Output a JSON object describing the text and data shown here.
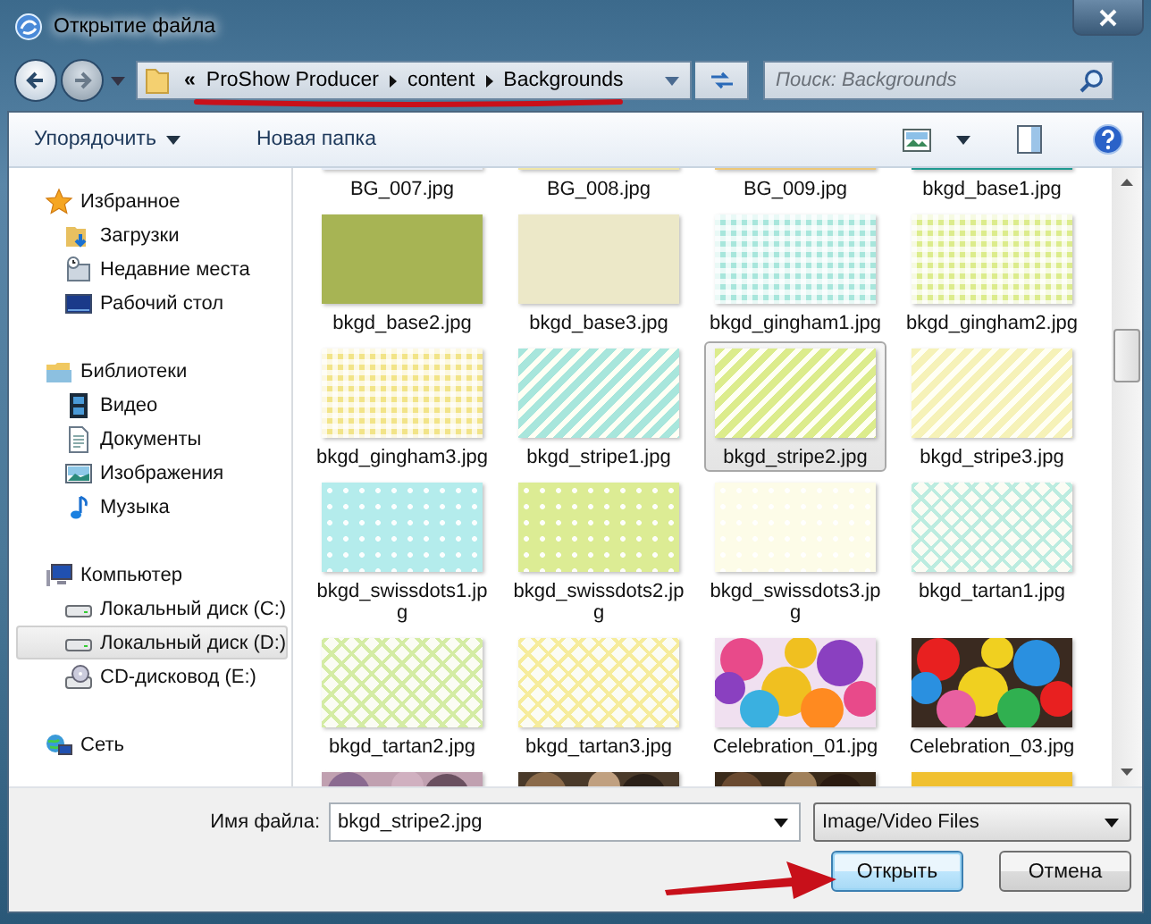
{
  "window": {
    "title": "Открытие файла"
  },
  "address": {
    "overflow": "«",
    "path": [
      "ProShow Producer",
      "content",
      "Backgrounds"
    ],
    "underlined": true
  },
  "search": {
    "placeholder": "Поиск: Backgrounds"
  },
  "toolbar": {
    "organize": "Упорядочить",
    "new_folder": "Новая папка"
  },
  "sidebar": {
    "groups": [
      {
        "label": "Избранное",
        "children": [
          {
            "label": "Загрузки",
            "selected": false
          },
          {
            "label": "Недавние места",
            "selected": false
          },
          {
            "label": "Рабочий стол",
            "selected": false
          }
        ]
      },
      {
        "label": "Библиотеки",
        "children": [
          {
            "label": "Видео",
            "selected": false
          },
          {
            "label": "Документы",
            "selected": false
          },
          {
            "label": "Изображения",
            "selected": false
          },
          {
            "label": "Музыка",
            "selected": false
          }
        ]
      },
      {
        "label": "Компьютер",
        "children": [
          {
            "label": "Локальный диск (C:)",
            "selected": false
          },
          {
            "label": "Локальный диск (D:)",
            "selected": true
          },
          {
            "label": "CD-дисковод (E:)",
            "selected": false
          }
        ]
      },
      {
        "label": "Сеть"
      }
    ]
  },
  "files": [
    {
      "name": "BG_007.jpg",
      "kind": "plain",
      "color": "#e8eef8",
      "selected": false
    },
    {
      "name": "BG_008.jpg",
      "kind": "plain",
      "color": "#f0e6a8",
      "selected": false
    },
    {
      "name": "BG_009.jpg",
      "kind": "plain",
      "color": "#ecc778",
      "selected": false
    },
    {
      "name": "bkgd_base1.jpg",
      "kind": "plain",
      "color": "#1f9a90",
      "selected": false
    },
    {
      "name": "bkgd_base2.jpg",
      "kind": "plain",
      "color": "#a7b454",
      "selected": false
    },
    {
      "name": "bkgd_base3.jpg",
      "kind": "plain",
      "color": "#ece8c8",
      "selected": false
    },
    {
      "name": "bkgd_gingham1.jpg",
      "kind": "gingham",
      "color": "#a8e6dc",
      "selected": false
    },
    {
      "name": "bkgd_gingham2.jpg",
      "kind": "gingham",
      "color": "#dcec8c",
      "selected": false
    },
    {
      "name": "bkgd_gingham3.jpg",
      "kind": "gingham",
      "color": "#f2e488",
      "selected": false
    },
    {
      "name": "bkgd_stripe1.jpg",
      "kind": "stripe",
      "color": "#a8e6dc",
      "selected": false
    },
    {
      "name": "bkgd_stripe2.jpg",
      "kind": "stripe",
      "color": "#dcec8c",
      "selected": true
    },
    {
      "name": "bkgd_stripe3.jpg",
      "kind": "stripe",
      "color": "#f6f2b8",
      "selected": false
    },
    {
      "name": "bkgd_swissdots1.jpg",
      "kind": "dots",
      "color": "#b4ecec",
      "selected": false
    },
    {
      "name": "bkgd_swissdots2.jpg",
      "kind": "dots",
      "color": "#dcec94",
      "selected": false
    },
    {
      "name": "bkgd_swissdots3.jpg",
      "kind": "dots",
      "color": "#fdfce8",
      "selected": false
    },
    {
      "name": "bkgd_tartan1.jpg",
      "kind": "tartan",
      "color": "#bcece0",
      "selected": false
    },
    {
      "name": "bkgd_tartan2.jpg",
      "kind": "tartan",
      "color": "#d4eca4",
      "selected": false
    },
    {
      "name": "bkgd_tartan3.jpg",
      "kind": "tartan",
      "color": "#f6ec9c",
      "selected": false
    },
    {
      "name": "Celebration_01.jpg",
      "kind": "picture",
      "selected": false
    },
    {
      "name": "Celebration_03.jpg",
      "kind": "picture",
      "selected": false
    },
    {
      "kind": "picture",
      "selected": false
    },
    {
      "kind": "picture",
      "selected": false
    },
    {
      "kind": "picture",
      "selected": false
    },
    {
      "kind": "plain",
      "color": "#f0c030",
      "selected": false
    }
  ],
  "bottom": {
    "filename_label": "Имя файла:",
    "filename": "bkgd_stripe2.jpg",
    "filetype": "Image/Video Files",
    "open": "Открыть",
    "cancel": "Отмена",
    "open_arrow": true
  }
}
